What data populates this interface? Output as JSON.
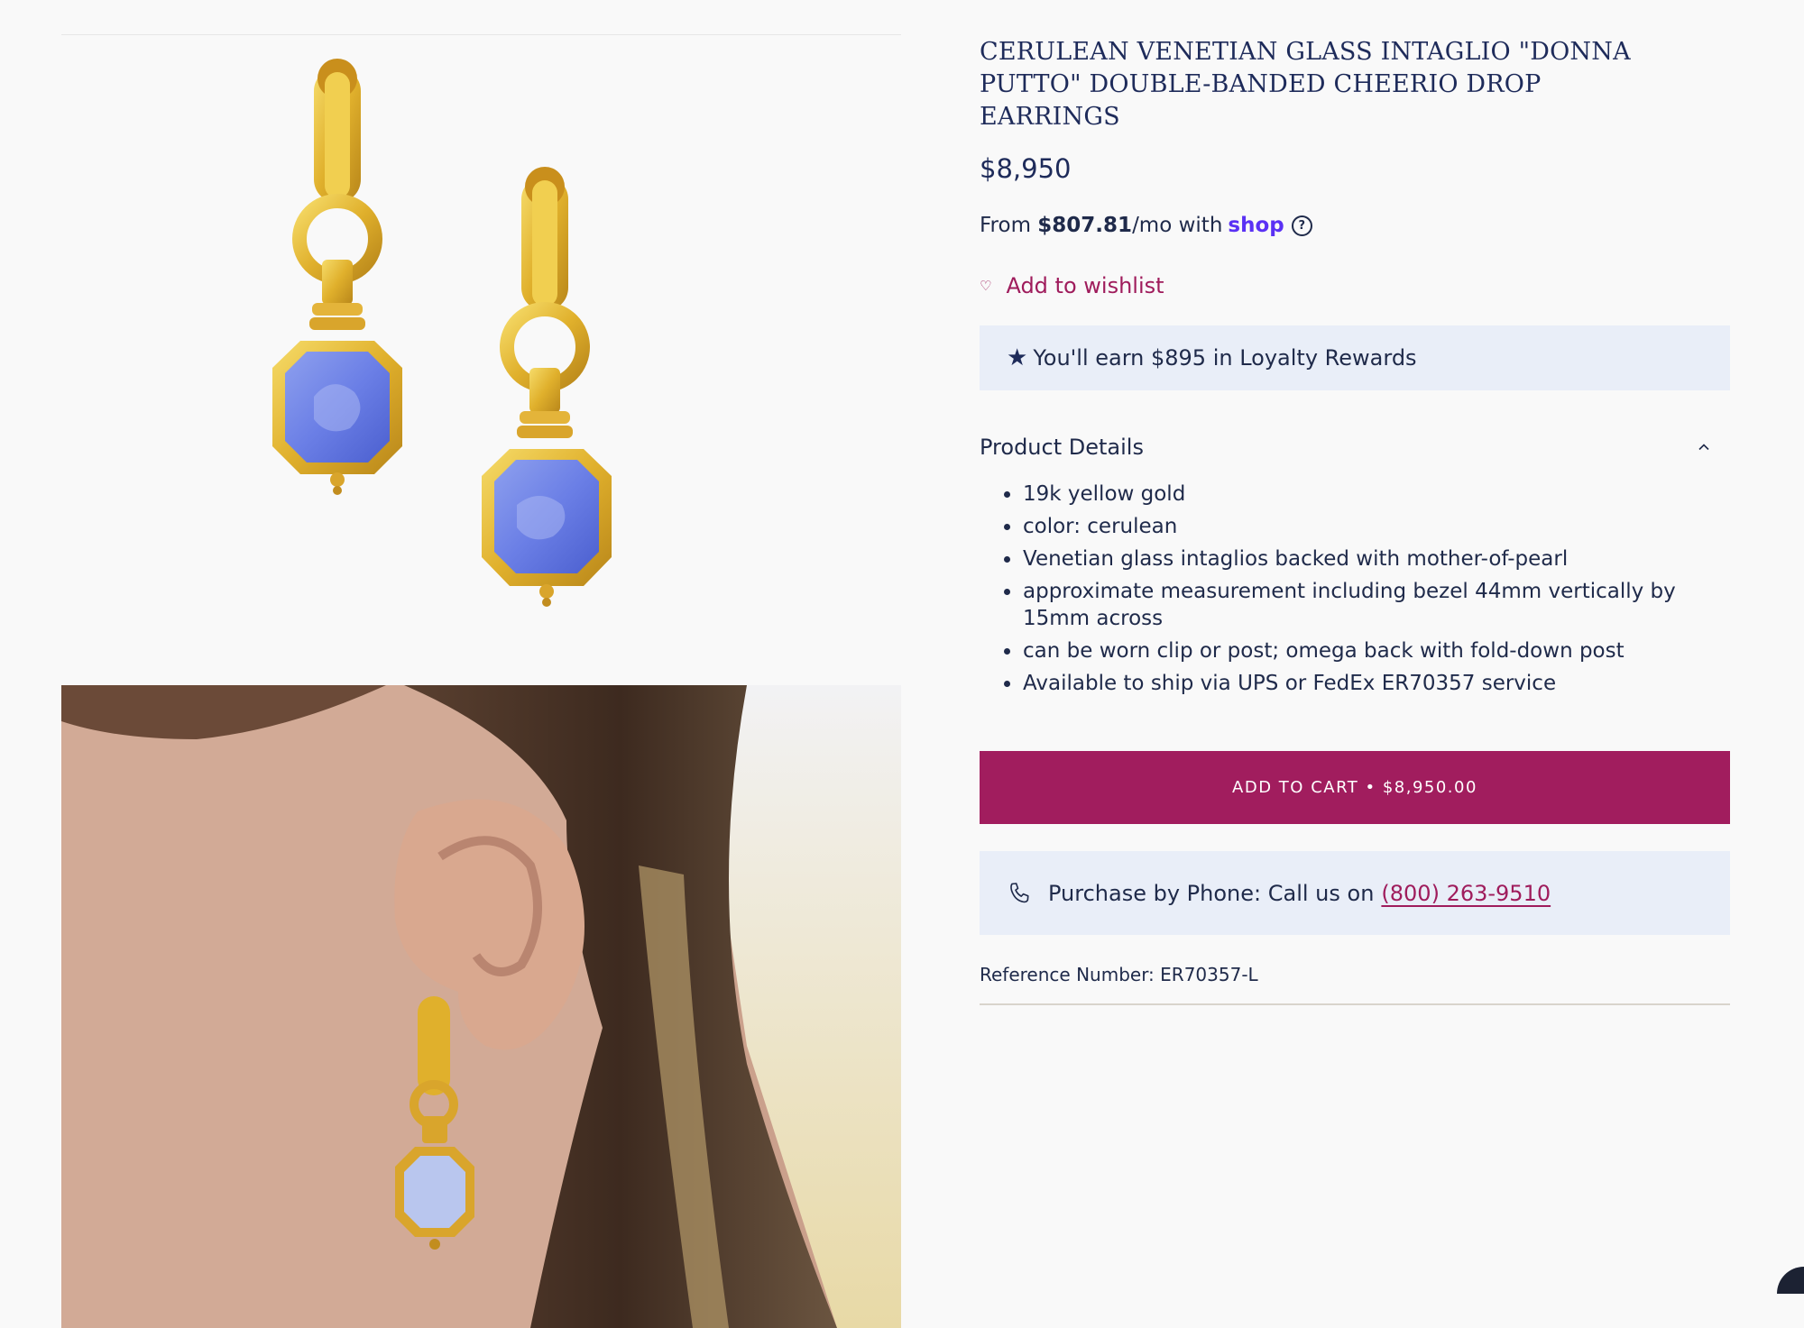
{
  "gallery": {
    "image1_alt": "Pair of gold earrings with cerulean Venetian glass intaglios",
    "image2_alt": "Earring worn on ear"
  },
  "product": {
    "title": "CERULEAN VENETIAN GLASS INTAGLIO \"DONNA PUTTO\" DOUBLE-BANDED CHEERIO DROP EARRINGS",
    "price": "$8,950"
  },
  "installments": {
    "prefix": "From",
    "amount": "$807.81",
    "suffix": "/mo with",
    "provider": "shop",
    "help_icon": "?"
  },
  "wishlist": {
    "icon": "heart-icon",
    "glyph": "♡",
    "label": "Add to wishlist"
  },
  "loyalty": {
    "icon": "star-icon",
    "glyph": "★",
    "text": "You'll earn $895 in Loyalty Rewards"
  },
  "details": {
    "title": "Product Details",
    "items": [
      "19k yellow gold",
      "color: cerulean",
      "Venetian glass intaglios backed with mother-of-pearl",
      "approximate measurement including bezel 44mm vertically by 15mm across",
      "can be worn clip or post; omega back with fold-down post",
      "Available to ship via UPS or FedEx ER70357 service"
    ]
  },
  "cart": {
    "label": "ADD TO CART • $8,950.00"
  },
  "phone": {
    "icon": "phone-icon",
    "text": "Purchase by Phone: Call us on",
    "number": "(800) 263-9510"
  },
  "reference": {
    "text": "Reference Number: ER70357-L"
  },
  "colors": {
    "navy": "#1e2b5a",
    "accent": "#a11d5e",
    "panel": "#e9eef8",
    "shop_purple": "#5a31f4"
  }
}
